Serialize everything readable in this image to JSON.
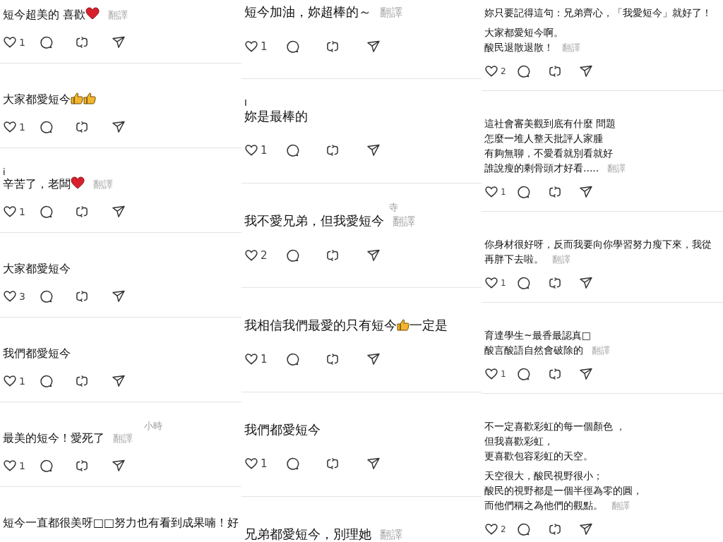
{
  "columns": [
    {
      "comments": [
        {
          "paragraphs": [
            [
              [
                "短今超美的 喜歡",
                {
                  "kind": "heart"
                }
              ]
            ]
          ],
          "translate": "翻譯",
          "likes": "1"
        },
        {
          "paragraphs": [
            [
              [
                "大家都愛短今",
                {
                  "kind": "thumbs"
                },
                {
                  "kind": "thumbs"
                }
              ]
            ]
          ],
          "likes": "1"
        },
        {
          "author": "i",
          "paragraphs": [
            [
              [
                "辛苦了，老闆",
                {
                  "kind": "heart"
                }
              ]
            ]
          ],
          "translate": "翻譯",
          "likes": "1"
        },
        {
          "paragraphs": [
            [
              "大家都愛短今"
            ]
          ],
          "likes": "3"
        },
        {
          "paragraphs": [
            [
              "我們都愛短今"
            ]
          ],
          "likes": "1"
        },
        {
          "time": "小時",
          "paragraphs": [
            [
              "最美的短今！愛死了"
            ]
          ],
          "translate": "翻譯",
          "likes": "1"
        },
        {
          "paragraphs": [
            [
              "短今一直都很美呀□□努力也有看到成果喃！好"
            ]
          ]
        }
      ]
    },
    {
      "comments": [
        {
          "paragraphs": [
            [
              "短今加油，妳超棒的～"
            ]
          ],
          "translate": "翻譯",
          "likes": "1"
        },
        {
          "author": "I",
          "paragraphs": [
            [
              "妳是最棒的"
            ]
          ],
          "likes": "1"
        },
        {
          "time": "寺",
          "paragraphs": [
            [
              "我不愛兄弟，但我愛短今"
            ]
          ],
          "translate": "翻譯",
          "likes": "2"
        },
        {
          "paragraphs": [
            [
              [
                "我相信我們最愛的只有短今",
                {
                  "kind": "thumbs"
                },
                "一定是"
              ]
            ]
          ],
          "likes": "1"
        },
        {
          "paragraphs": [
            [
              "我們都愛短今"
            ]
          ],
          "likes": "1"
        },
        {
          "paragraphs": [
            [
              "兄弟都愛短今，別理她"
            ]
          ],
          "translate": "翻譯"
        }
      ]
    },
    {
      "comments": [
        {
          "paragraphs": [
            [
              "妳只要記得這句：兄弟齊心，「我愛短今」就好了！"
            ],
            [
              "大家都愛短今啊。",
              "酸民退散退散！"
            ]
          ],
          "translate": "翻譯",
          "likes": "2"
        },
        {
          "paragraphs": [
            [
              "這社會審美觀到底有什麼 問題",
              "怎麼一堆人整天批評人家腫",
              "有夠無聊，不愛看就別看就好",
              "誰說瘦的剩骨頭才好看....."
            ]
          ],
          "translate": "翻譯",
          "likes": "1"
        },
        {
          "paragraphs": [
            [
              "你身材很好呀，反而我要向你學習努力瘦下來，我從",
              "再胖下去啦。"
            ]
          ],
          "translate": "翻譯",
          "likes": "1"
        },
        {
          "paragraphs": [
            [
              "育達學生~最香最認真□",
              "酸言酸語自然會破除的"
            ]
          ],
          "translate": "翻譯",
          "likes": "1"
        },
        {
          "paragraphs": [
            [
              "不一定喜歡彩虹的每一個顏色 ，",
              "但我喜歡彩虹，",
              "更喜歡包容彩虹的天空。"
            ],
            [
              "天空很大，酸民視野很小；",
              "酸民的視野都是一個半徑為零的圓，",
              "而他們稱之為他們的觀點。"
            ]
          ],
          "translate": "翻譯",
          "likes": "2"
        }
      ]
    }
  ]
}
